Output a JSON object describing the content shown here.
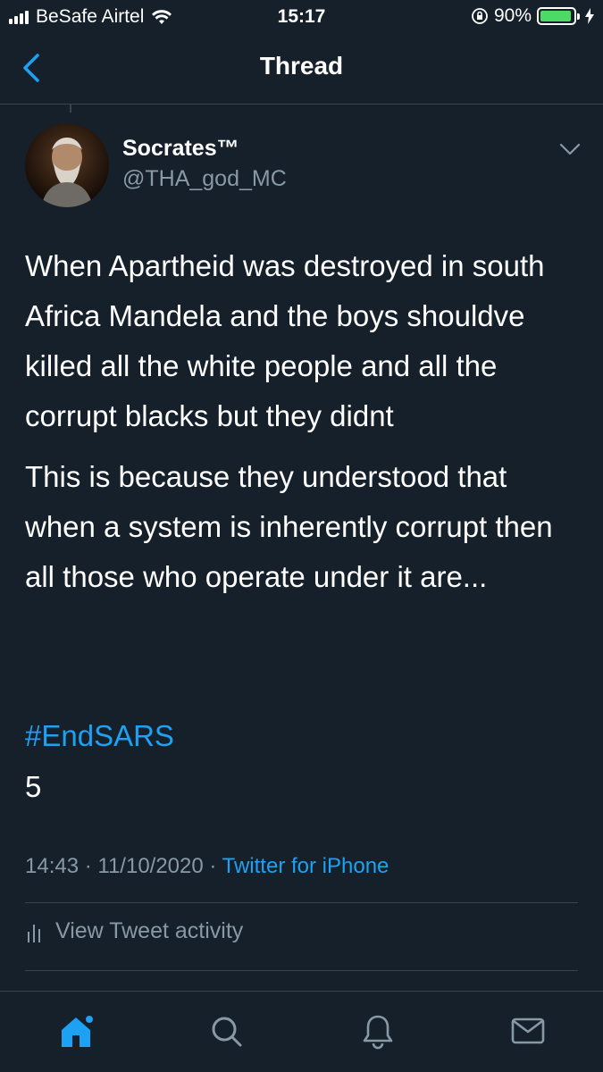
{
  "status_bar": {
    "carrier": "BeSafe Airtel",
    "time": "15:17",
    "battery": "90%",
    "battery_level": 0.9
  },
  "nav": {
    "title": "Thread",
    "back_icon": "chevron-left-icon"
  },
  "tweet": {
    "author_name": "Socrates™",
    "author_handle": "@THA_god_MC",
    "paragraphs": [
      "When Apartheid was destroyed in south Africa Mandela and the boys shouldve killed all the white people and all the corrupt blacks but they didnt",
      "This is because they understood that when a system is inherently corrupt then all those who operate under it are..."
    ],
    "hashtag": "#EndSARS",
    "count": "5",
    "time": "14:43",
    "date": "11/10/2020",
    "source": "Twitter for iPhone",
    "separator": " · "
  },
  "actions": {
    "view_activity": "View Tweet activity"
  },
  "tabbar": {
    "items": [
      {
        "icon": "home-icon",
        "active": true
      },
      {
        "icon": "search-icon",
        "active": false
      },
      {
        "icon": "bell-icon",
        "active": false
      },
      {
        "icon": "mail-icon",
        "active": false
      }
    ]
  },
  "colors": {
    "background": "#15202b",
    "accent": "#1da1f2",
    "muted": "#8899a6",
    "battery": "#4cd964"
  }
}
